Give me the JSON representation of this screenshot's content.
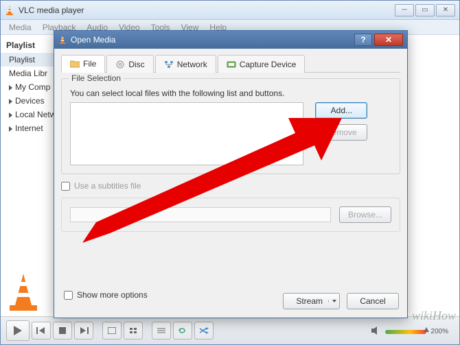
{
  "app": {
    "title": "VLC media player"
  },
  "menu": [
    "Media",
    "Playback",
    "Audio",
    "Video",
    "Tools",
    "View",
    "Help"
  ],
  "sidebar": {
    "header": "Playlist",
    "items": [
      {
        "label": "Playlist",
        "expandable": false,
        "selected": true
      },
      {
        "label": "Media Libr",
        "expandable": false
      },
      {
        "label": "My Comp",
        "expandable": true
      },
      {
        "label": "Devices",
        "expandable": true
      },
      {
        "label": "Local Netw",
        "expandable": true
      },
      {
        "label": "Internet",
        "expandable": true
      }
    ]
  },
  "volume": {
    "percent_label": "200%"
  },
  "dialog": {
    "title": "Open Media",
    "tabs": [
      {
        "label": "File",
        "icon": "folder-icon"
      },
      {
        "label": "Disc",
        "icon": "disc-icon"
      },
      {
        "label": "Network",
        "icon": "network-icon"
      },
      {
        "label": "Capture Device",
        "icon": "capture-icon"
      }
    ],
    "group_title": "File Selection",
    "hint": "You can select local files with the following list and buttons.",
    "add_label": "Add...",
    "remove_label": "Remove",
    "subtitles_label": "Use a subtitles file",
    "browse_label": "Browse...",
    "show_more_label": "Show more options",
    "stream_label": "Stream",
    "cancel_label": "Cancel"
  },
  "watermark": "wikiHow"
}
